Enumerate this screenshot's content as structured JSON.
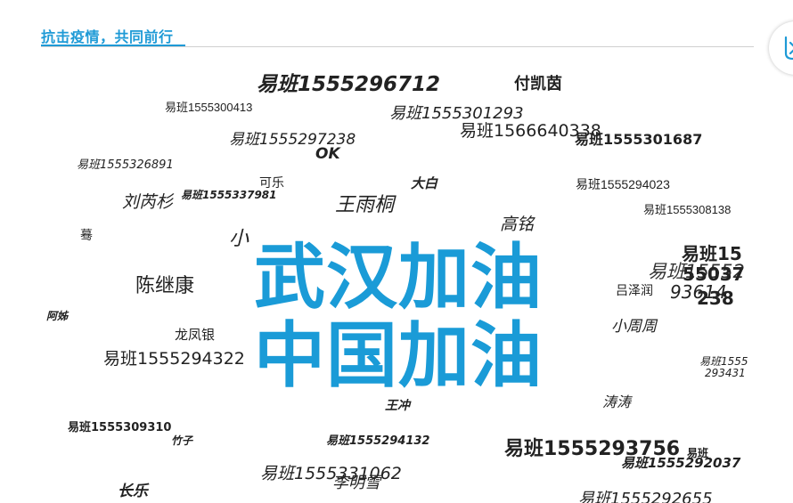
{
  "header": {
    "title": "抗击疫情，共同前行"
  },
  "colors": {
    "accent": "#1e9ad6",
    "banner": "#1a9bd7",
    "text": "#222222",
    "rule": "#d0d0d0"
  },
  "side_button": {
    "icon": "share-icon"
  },
  "banner": {
    "line1": "武汉加油",
    "line2": "中国加油"
  },
  "words": [
    {
      "text": "易班1555296712"
    },
    {
      "text": "付凯茵"
    },
    {
      "text": "易班1555300413"
    },
    {
      "text": "易班1555301293"
    },
    {
      "text": "易班1566640338"
    },
    {
      "text": "易班1555301687"
    },
    {
      "text": "易班1555297238"
    },
    {
      "text": "OK"
    },
    {
      "text": "易班1555326891"
    },
    {
      "text": "可乐"
    },
    {
      "text": "大白"
    },
    {
      "text": "易班1555294023"
    },
    {
      "text": "刘芮杉"
    },
    {
      "text": "易班1555337981"
    },
    {
      "text": "王雨桐"
    },
    {
      "text": "易班1555308138"
    },
    {
      "text": "高铭"
    },
    {
      "text": "蓦"
    },
    {
      "text": "小"
    },
    {
      "text": "易班15"
    },
    {
      "text": "易班15552"
    },
    {
      "text": "55037"
    },
    {
      "text": "陈继康"
    },
    {
      "text": "吕泽润"
    },
    {
      "text": "93614"
    },
    {
      "text": "238"
    },
    {
      "text": "阿姊"
    },
    {
      "text": "小周周"
    },
    {
      "text": "龙凤银"
    },
    {
      "text": "易班1555294322"
    },
    {
      "text": "易班1555"
    },
    {
      "text": "293431"
    },
    {
      "text": "涛涛"
    },
    {
      "text": "王冲"
    },
    {
      "text": "易班1555309310"
    },
    {
      "text": "竹子"
    },
    {
      "text": "易班1555294132"
    },
    {
      "text": "易班1555293756"
    },
    {
      "text": "易班"
    },
    {
      "text": "易班1555292037"
    },
    {
      "text": "易班1555331062"
    },
    {
      "text": "李明雪"
    },
    {
      "text": "长乐"
    },
    {
      "text": "易班1555292655"
    }
  ]
}
